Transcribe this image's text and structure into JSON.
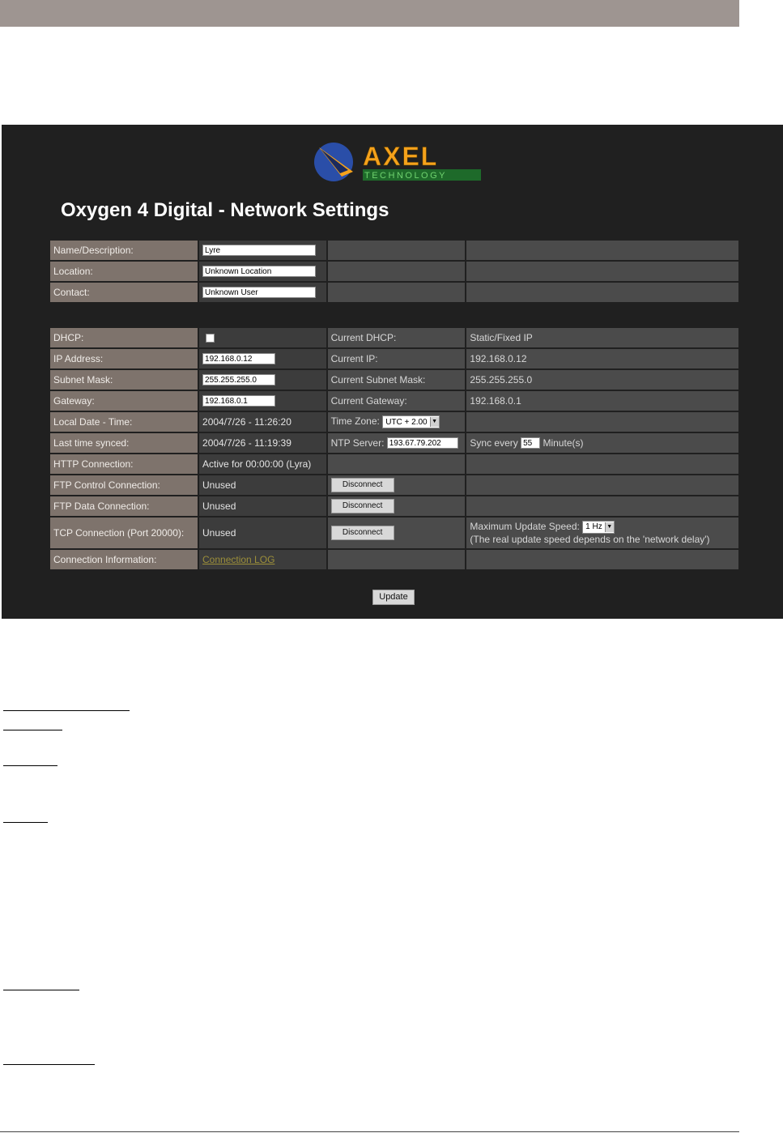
{
  "header": {
    "title": "Oxygen 4 Digital - Network Settings"
  },
  "logo": {
    "brand": "AXEL",
    "sub": "TECHNOLOGY",
    "colors": {
      "brand": "#f5a21b",
      "sub": "#3aa845",
      "globe": "#2a4ea8"
    }
  },
  "identity": {
    "name_label": "Name/Description:",
    "name_value": "Lyre",
    "location_label": "Location:",
    "location_value": "Unknown Location",
    "contact_label": "Contact:",
    "contact_value": "Unknown User"
  },
  "network": {
    "dhcp_label": "DHCP:",
    "current_dhcp_label": "Current DHCP:",
    "current_dhcp_value": "Static/Fixed IP",
    "ip_label": "IP Address:",
    "ip_value": "192.168.0.12",
    "current_ip_label": "Current IP:",
    "current_ip_value": "192.168.0.12",
    "subnet_label": "Subnet Mask:",
    "subnet_value": "255.255.255.0",
    "current_subnet_label": "Current Subnet Mask:",
    "current_subnet_value": "255.255.255.0",
    "gateway_label": "Gateway:",
    "gateway_value": "192.168.0.1",
    "current_gateway_label": "Current Gateway:",
    "current_gateway_value": "192.168.0.1",
    "local_time_label": "Local Date - Time:",
    "local_time_value": "2004/7/26 - 11:26:20",
    "timezone_label": "Time Zone:",
    "timezone_value": "UTC + 2.00",
    "last_synced_label": "Last time synced:",
    "last_synced_value": "2004/7/26 - 11:19:39",
    "ntp_label": "NTP Server:",
    "ntp_value": "193.67.79.202",
    "sync_every_label": "Sync every",
    "sync_every_value": "55",
    "sync_unit": "Minute(s)",
    "http_label": "HTTP Connection:",
    "http_value": "Active for 00:00:00 (Lyra)",
    "ftp_control_label": "FTP Control Connection:",
    "ftp_control_value": "Unused",
    "ftp_data_label": "FTP Data Connection:",
    "ftp_data_value": "Unused",
    "tcp_label": "TCP Connection (Port 20000):",
    "tcp_value": "Unused",
    "disconnect_label": "Disconnect",
    "max_speed_label": "Maximum Update Speed:",
    "max_speed_value": "1 Hz",
    "max_speed_note": "(The real update speed depends on the 'network delay')",
    "conn_info_label": "Connection Information:",
    "conn_info_link": "Connection LOG"
  },
  "footer": {
    "update_label": "Update"
  }
}
